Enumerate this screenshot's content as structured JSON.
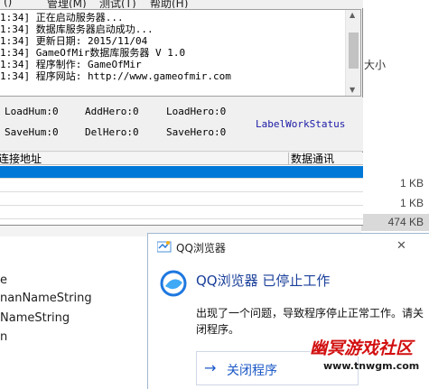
{
  "menubar": {
    "items": [
      "()",
      "管理(M)",
      "测试(T)",
      "帮助(H)"
    ]
  },
  "log": {
    "lines": [
      "1:34] 正在启动服务器...",
      "1:34] 数据库服务器启动成功...",
      "1:34] 更新日期: 2015/11/04",
      "1:34] GameOfMir数据库服务器 V 1.0",
      "1:34] 程序制作: GameOfMir",
      "1:34] 程序网站: http://www.gameofmir.com"
    ]
  },
  "stats": {
    "load_hum": "LoadHum:0",
    "add_hero": "AddHero:0",
    "load_hero": "LoadHero:0",
    "save_hum": "SaveHum:0",
    "del_hero": "DelHero:0",
    "save_hero": "SaveHero:0",
    "status_label": "LabelWorkStatus"
  },
  "grid": {
    "col1": "连接地址",
    "col2": "数据通讯"
  },
  "explorer": {
    "size_header": "大小",
    "sizes": [
      "1 KB",
      "1 KB",
      "474 KB"
    ]
  },
  "leftpanel": {
    "lines": [
      "e",
      "nanNameString",
      "NameString",
      "n"
    ]
  },
  "dialog": {
    "title": "QQ浏览器",
    "close": "✕",
    "heading": "QQ浏览器 已停止工作",
    "message": "出现了一个问题，导致程序停止正常工作。请关闭程序。",
    "button_arrow": "→",
    "button_label": "关闭程序"
  },
  "watermark": {
    "text": "幽冥游戏社区",
    "url": "www.tnwgm.com"
  },
  "colors": {
    "selection": "#0078d7",
    "dialog_heading": "#1a3f9a",
    "watermark": "#d21010"
  }
}
